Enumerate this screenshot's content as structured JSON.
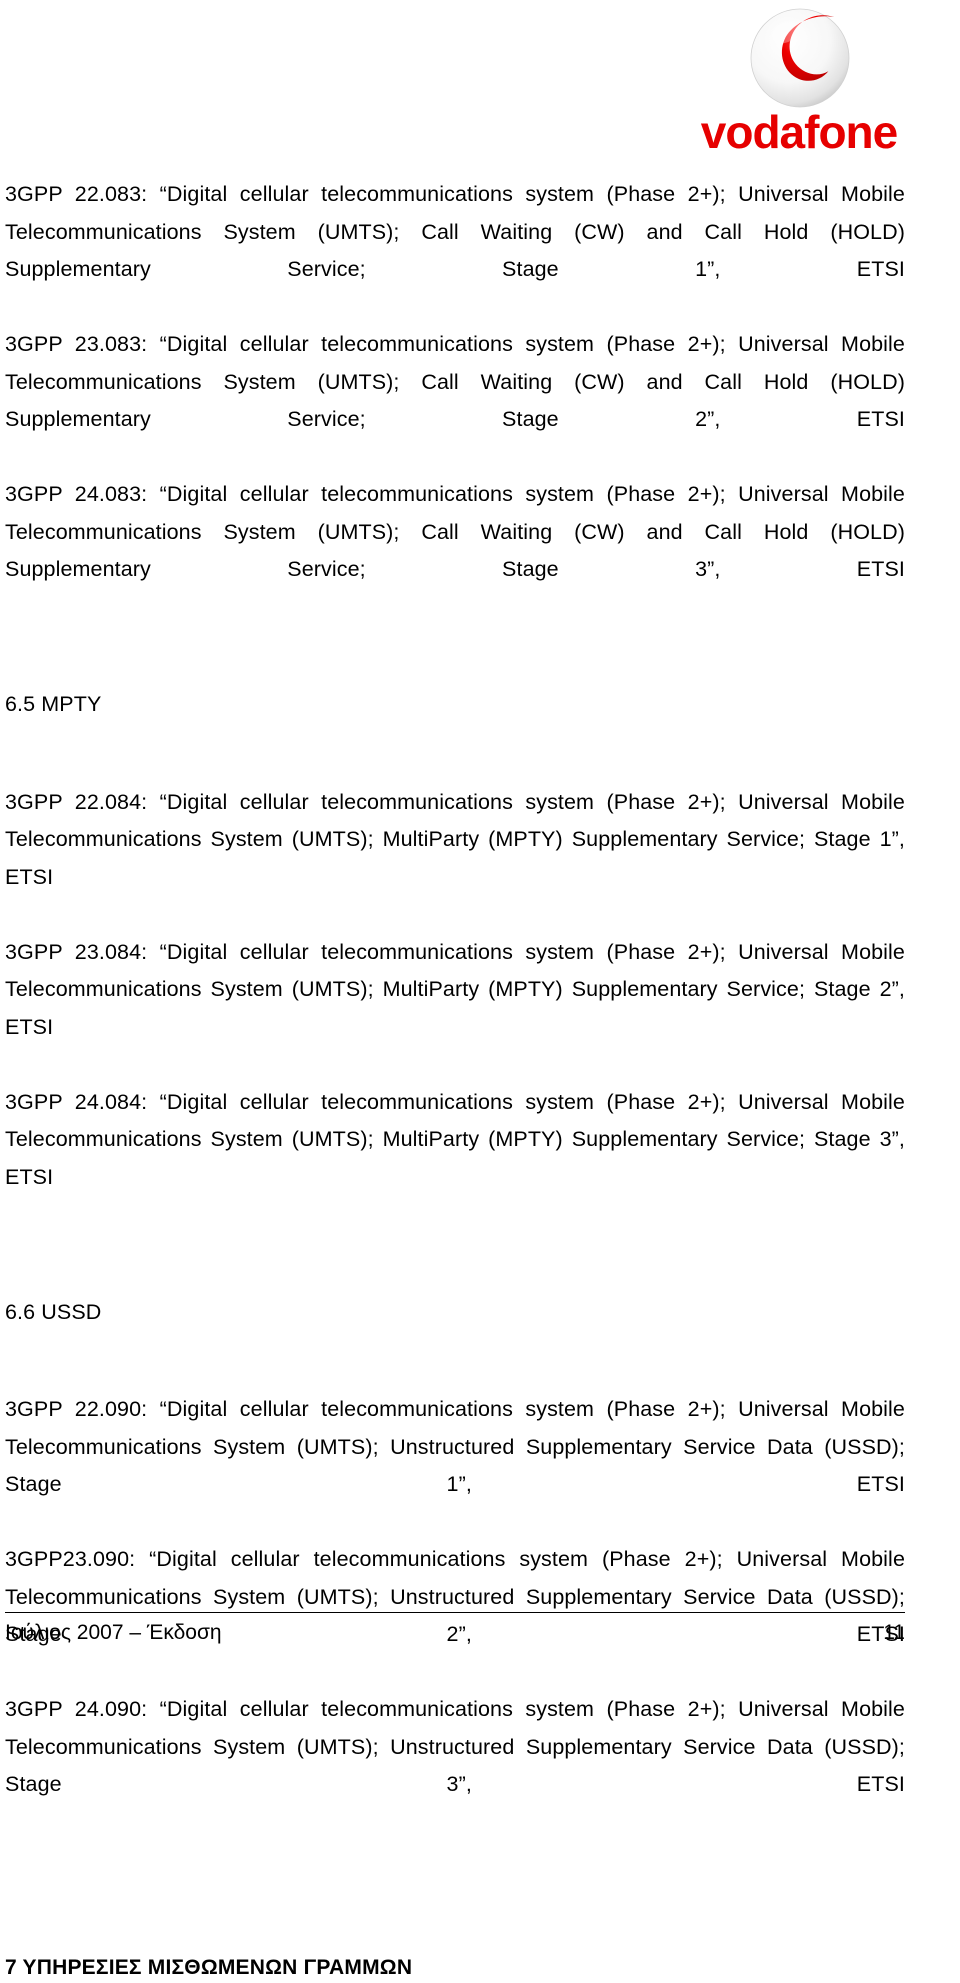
{
  "logo": {
    "brand_name": "vodafone",
    "mark_name": "vodafone-speechmark",
    "colors": {
      "red": "#E60000",
      "sphere_light": "#FFFFFF",
      "sphere_shade": "#C9C9C9"
    }
  },
  "document": {
    "blocks": [
      {
        "kind": "reference",
        "text": "3GPP 22.083: “Digital cellular telecommunications system (Phase 2+); Universal Mobile Telecommunications System (UMTS); Call Waiting (CW) and Call Hold (HOLD) Supplementary Service; Stage 1”, ETSI"
      },
      {
        "kind": "reference",
        "text": "3GPP 23.083: “Digital cellular telecommunications system (Phase 2+); Universal Mobile Telecommunications System (UMTS); Call Waiting (CW) and Call Hold (HOLD) Supplementary Service; Stage 2”, ETSI"
      },
      {
        "kind": "reference",
        "text": "3GPP 24.083: “Digital cellular telecommunications system (Phase 2+); Universal Mobile Telecommunications System (UMTS); Call Waiting (CW) and Call Hold (HOLD) Supplementary Service; Stage 3”, ETSI"
      },
      {
        "kind": "heading",
        "text": "6.5 MPTY"
      },
      {
        "kind": "reference",
        "text": "3GPP 22.084: “Digital cellular telecommunications system (Phase 2+); Universal Mobile Telecommunications System (UMTS); MultiParty (MPTY) Supplementary Service; Stage 1”, ETSI"
      },
      {
        "kind": "reference",
        "text": "3GPP 23.084: “Digital cellular telecommunications system (Phase 2+); Universal Mobile Telecommunications System (UMTS); MultiParty (MPTY) Supplementary Service; Stage 2”, ETSI"
      },
      {
        "kind": "reference",
        "text": "3GPP 24.084: “Digital cellular telecommunications system (Phase 2+); Universal Mobile Telecommunications System (UMTS); MultiParty (MPTY) Supplementary Service; Stage 3”, ETSI"
      },
      {
        "kind": "heading",
        "text": "6.6 USSD"
      },
      {
        "kind": "reference",
        "text": "3GPP 22.090: “Digital cellular telecommunications system (Phase 2+); Universal Mobile Telecommunications System (UMTS); Unstructured Supplementary Service Data (USSD); Stage 1”, ETSI"
      },
      {
        "kind": "reference",
        "text": "3GPP23.090: “Digital cellular telecommunications system (Phase 2+); Universal Mobile Telecommunications System (UMTS); Unstructured Supplementary Service Data (USSD); Stage 2”, ETSI"
      },
      {
        "kind": "reference",
        "text": "3GPP 24.090: “Digital cellular telecommunications system (Phase 2+); Universal Mobile Telecommunications System (UMTS); Unstructured Supplementary Service Data (USSD); Stage 3”, ETSI"
      }
    ],
    "chapter_heading": "7 ΥΠΗΡΕΣΙΕΣ ΜΙΣΘΩΜΕΝΩΝ ΓΡΑΜΜΩΝ"
  },
  "footer": {
    "left": "Ιούλιος 2007 – Έκδοση",
    "page_number": "11"
  }
}
